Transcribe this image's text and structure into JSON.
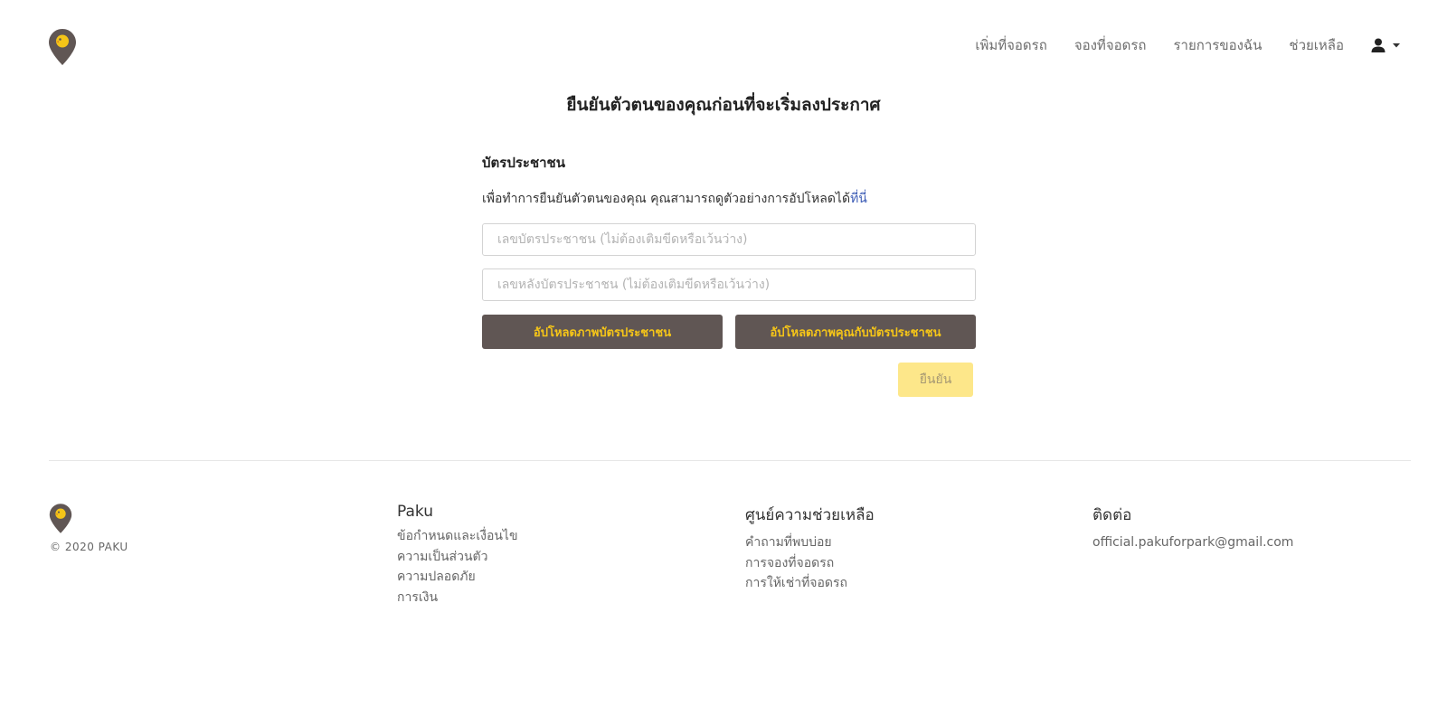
{
  "brand": {
    "colors": {
      "accent": "#f5c518",
      "dark": "#605654",
      "confirm_disabled": "#fde78a",
      "link": "#3b5bb5"
    }
  },
  "nav": {
    "items": [
      "เพิ่มที่จอดรถ",
      "จองที่จอดรถ",
      "รายการของฉัน",
      "ช่วยเหลือ"
    ],
    "user_icon": "user-icon",
    "caret_icon": "caret-down-icon"
  },
  "page": {
    "title": "ยืนยันตัวตนของคุณก่อนที่จะเริ่มลงประกาศ",
    "section_label": "บัตรประชาชน",
    "help_text": "เพื่อทำการยืนยันตัวตนของคุณ คุณสามารถดูตัวอย่างการอัปโหลดได้",
    "help_link": "ที่นี่",
    "id_number_placeholder": "เลขบัตรประชาชน (ไม่ต้องเติมขีดหรือเว้นว่าง)",
    "id_number_value": "",
    "back_number_placeholder": "เลขหลังบัตรประชาชน (ไม่ต้องเติมขีดหรือเว้นว่าง)",
    "back_number_value": "",
    "upload_card_label": "อัปโหลดภาพบัตรประชาชน",
    "upload_selfie_label": "อัปโหลดภาพคุณกับบัตรประชาชน",
    "confirm_label": "ยืนยัน"
  },
  "footer": {
    "copyright": "© 2020 PAKU",
    "columns": [
      {
        "title": "Paku",
        "links": [
          "ข้อกำหนดและเงื่อนไข",
          "ความเป็นส่วนตัว",
          "ความปลอดภัย",
          "การเงิน"
        ]
      },
      {
        "title": "ศูนย์ความช่วยเหลือ",
        "links": [
          "คำถามที่พบบ่อย",
          "การจองที่จอดรถ",
          "การให้เช่าที่จอดรถ"
        ]
      },
      {
        "title": "ติดต่อ",
        "links": [
          "official.pakuforpark@gmail.com"
        ]
      }
    ]
  }
}
